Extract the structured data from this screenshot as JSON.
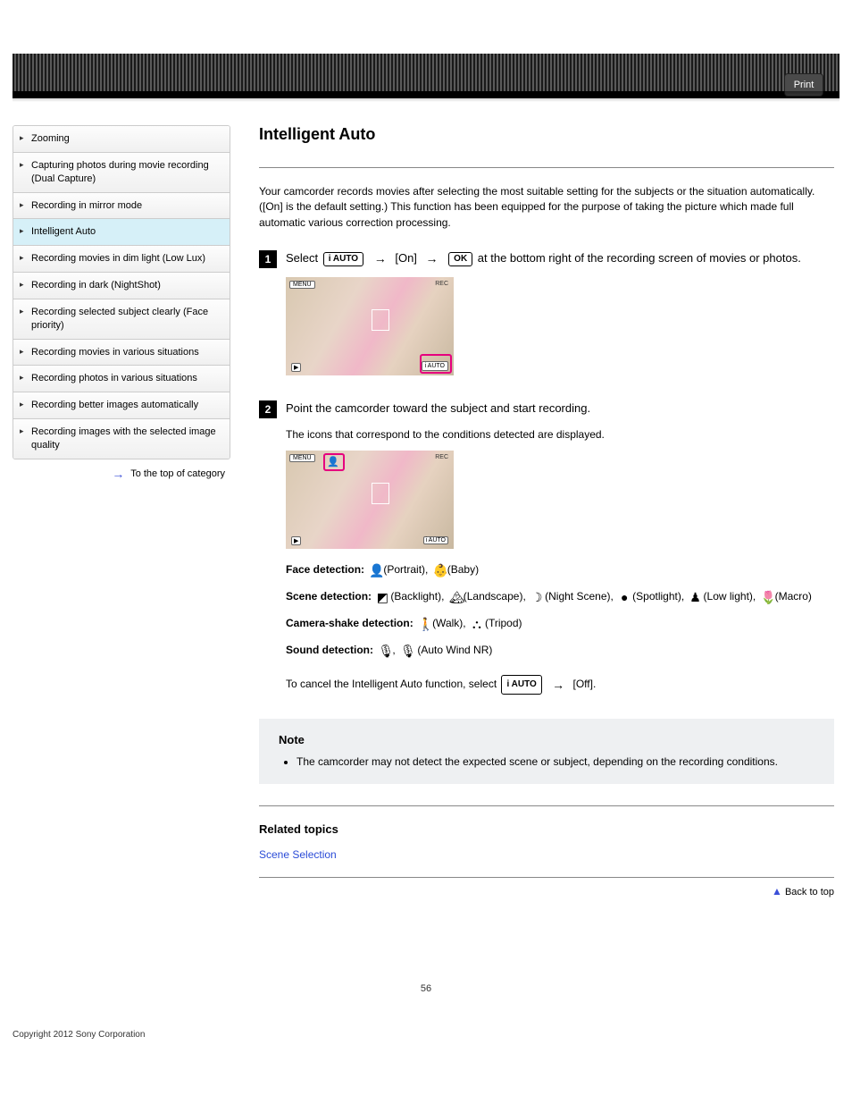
{
  "header": {
    "print": "Print"
  },
  "sidebar": {
    "items": [
      {
        "label": "Zooming"
      },
      {
        "label": "Capturing photos during movie recording (Dual Capture)"
      },
      {
        "label": "Recording in mirror mode"
      },
      {
        "label": "Intelligent Auto"
      },
      {
        "label": "Recording movies in dim light (Low Lux)"
      },
      {
        "label": "Recording in dark (NightShot)"
      },
      {
        "label": "Recording selected subject clearly (Face priority)"
      },
      {
        "label": "Recording movies in various situations"
      },
      {
        "label": "Recording photos in various situations"
      },
      {
        "label": "Recording better images automatically"
      },
      {
        "label": "Recording images with the selected image quality"
      }
    ],
    "active_index": 3,
    "to_top": "To the top of category"
  },
  "main": {
    "title": "Intelligent Auto",
    "intro": "Your camcorder records movies after selecting the most suitable setting for the subjects or the situation automatically. ([On] is the default setting.) This function has been equipped for the purpose of taking the picture which made full automatic various correction processing.",
    "step1": {
      "prefix": "Select ",
      "icon1": "i AUTO",
      "mid": " → [On] → ",
      "ok": "OK",
      "suffix": " at the bottom right of the recording screen of movies or photos."
    },
    "step2": {
      "text": "Point the camcorder toward the subject and start recording.",
      "caption": "The icons that correspond to the conditions detected are displayed."
    },
    "detections": {
      "face_label": "Face detection:",
      "face_vals": "(Portrait), ",
      "face_vals2": "(Baby)",
      "scene_label": "Scene detection:",
      "scene_vals": [
        "(Backlight)",
        "(Landscape)",
        "(Night Scene)",
        "(Spotlight)",
        "(Low light)",
        "(Macro)"
      ],
      "shake_label": "Camera-shake detection:",
      "shake_vals": [
        "(Walk)",
        "(Tripod)"
      ],
      "sound_label": "Sound detection:",
      "sound_vals": "(Auto Wind NR)"
    },
    "cancel": {
      "prefix": "To cancel the Intelligent Auto function, select ",
      "icon": "i AUTO",
      "suffix": " → [Off]."
    },
    "note": {
      "title": "Note",
      "item": "The camcorder may not detect the expected scene or subject, depending on the recording conditions."
    },
    "related": {
      "title": "Related topics",
      "link": "Scene Selection"
    },
    "back_top": "Back to top"
  },
  "footer": {
    "page": "56",
    "copyright": "Copyright 2012 Sony Corporation"
  }
}
